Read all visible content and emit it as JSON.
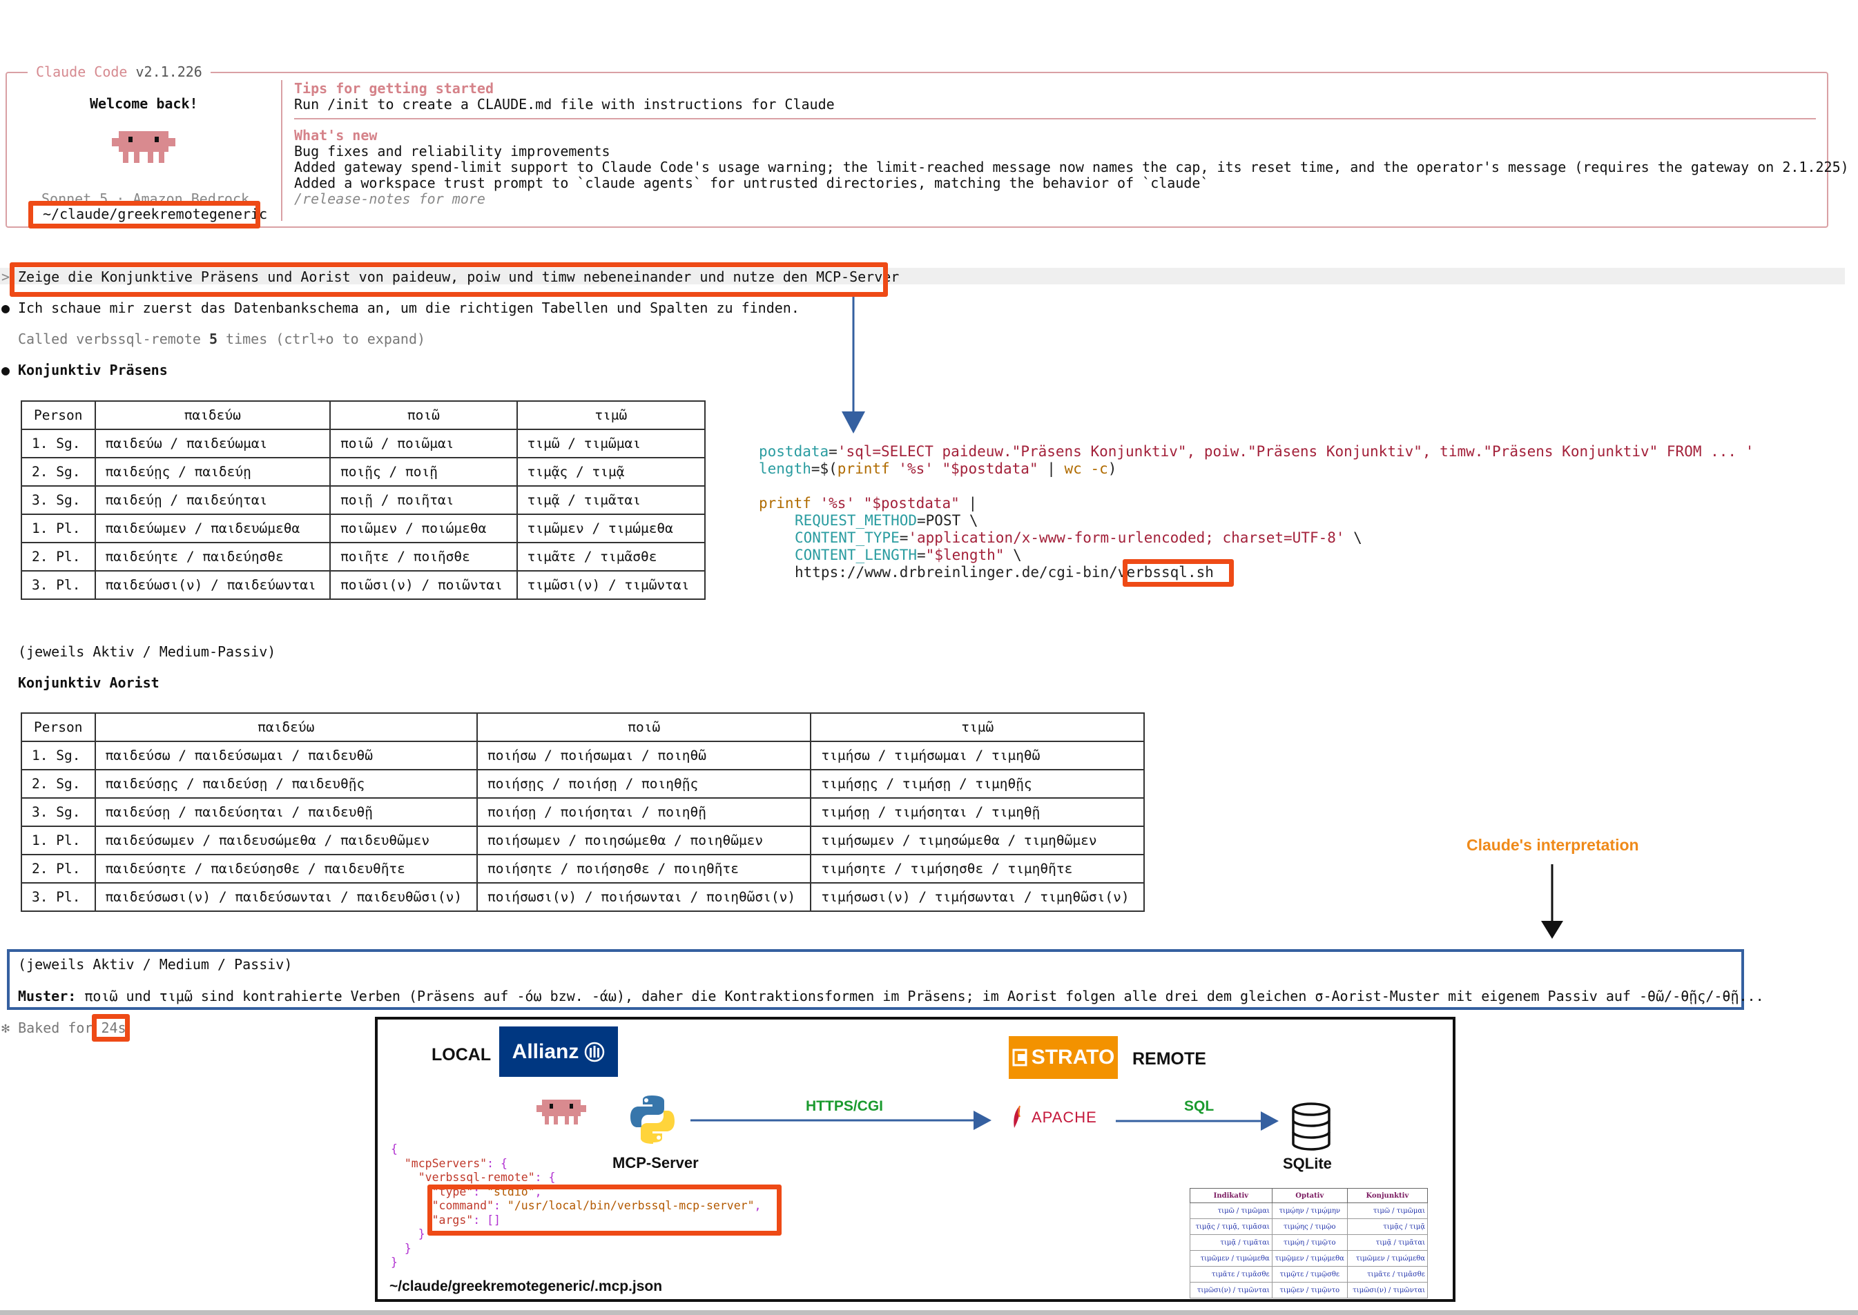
{
  "header": {
    "app_name": "Claude Code",
    "version": "v2.1.226",
    "welcome": "Welcome back!",
    "model": "Sonnet 5 · Amazon Bedrock",
    "cwd": "~/claude/greekremotegeneric",
    "tips_title": "Tips for getting started",
    "tips_line": "Run /init to create a CLAUDE.md file with instructions for Claude",
    "whats_new_title": "What's new",
    "whats_new": [
      "Bug fixes and reliability improvements",
      "Added gateway spend-limit support to Claude Code's usage warning; the limit-reached message now names the cap, its reset time, and the operator's message (requires the gateway on 2.1.225)",
      "Added a workspace trust prompt to `claude agents` for untrusted directories, matching the behavior of `claude`"
    ],
    "release_notes": "/release-notes for more"
  },
  "conversation": {
    "prompt_marker": ">",
    "prompt": "Zeige die Konjunktive Präsens und Aorist von paideuw, poiw und timw nebeneinander und nutze den MCP-Server",
    "bullet": "●",
    "msg1": "Ich schaue mir zuerst das Datenbankschema an, um die richtigen Tabellen und Spalten zu finden.",
    "called_prefix": "Called verbssql-remote ",
    "called_count": "5",
    "called_suffix": " times (ctrl+o to expand)",
    "section1_title": "Konjunktiv Präsens",
    "section2_title": "Konjunktiv Aorist",
    "note1": "(jeweils Aktiv / Medium-Passiv)",
    "note2": "(jeweils Aktiv / Medium / Passiv)",
    "muster_label": "Muster:",
    "muster_text": " ποιῶ und τιμῶ sind kontrahierte Verben (Präsens auf -όω bzw. -άω), daher die Kontraktionsformen im Präsens; im Aorist folgen alle drei dem gleichen σ-Aorist-Muster mit eigenem Passiv auf -θῶ/-θῇς/-θῇ...",
    "baked_star": "✻",
    "baked_label": "Baked for",
    "baked_time": "24s"
  },
  "table_praesens": {
    "headers": [
      "Person",
      "παιδεύω",
      "ποιῶ",
      "τιμῶ"
    ],
    "rows": [
      [
        "1. Sg.",
        "παιδεύω / παιδεύωμαι",
        "ποιῶ / ποιῶμαι",
        "τιμῶ / τιμῶμαι"
      ],
      [
        "2. Sg.",
        "παιδεύῃς / παιδεύῃ",
        "ποιῇς / ποιῇ",
        "τιμᾷς / τιμᾷ"
      ],
      [
        "3. Sg.",
        "παιδεύῃ / παιδεύηται",
        "ποιῇ / ποιῆται",
        "τιμᾷ / τιμᾶται"
      ],
      [
        "1. Pl.",
        "παιδεύωμεν / παιδευώμεθα",
        "ποιῶμεν / ποιώμεθα",
        "τιμῶμεν / τιμώμεθα"
      ],
      [
        "2. Pl.",
        "παιδεύητε / παιδεύησθε",
        "ποιῆτε / ποιῆσθε",
        "τιμᾶτε / τιμᾶσθε"
      ],
      [
        "3. Pl.",
        "παιδεύωσι(ν) / παιδεύωνται",
        "ποιῶσι(ν) / ποιῶνται",
        "τιμῶσι(ν) / τιμῶνται"
      ]
    ]
  },
  "table_aorist": {
    "headers": [
      "Person",
      "παιδεύω",
      "ποιῶ",
      "τιμῶ"
    ],
    "rows": [
      [
        "1. Sg.",
        "παιδεύσω / παιδεύσωμαι / παιδευθῶ",
        "ποιήσω / ποιήσωμαι / ποιηθῶ",
        "τιμήσω / τιμήσωμαι / τιμηθῶ"
      ],
      [
        "2. Sg.",
        "παιδεύσῃς / παιδεύσῃ / παιδευθῇς",
        "ποιήσῃς / ποιήσῃ / ποιηθῇς",
        "τιμήσῃς / τιμήσῃ / τιμηθῇς"
      ],
      [
        "3. Sg.",
        "παιδεύσῃ / παιδεύσηται / παιδευθῇ",
        "ποιήσῃ / ποιήσηται / ποιηθῇ",
        "τιμήσῃ / τιμήσηται / τιμηθῇ"
      ],
      [
        "1. Pl.",
        "παιδεύσωμεν / παιδευσώμεθα / παιδευθῶμεν",
        "ποιήσωμεν / ποιησώμεθα / ποιηθῶμεν",
        "τιμήσωμεν / τιμησώμεθα / τιμηθῶμεν"
      ],
      [
        "2. Pl.",
        "παιδεύσητε / παιδεύσησθε / παιδευθῆτε",
        "ποιήσητε / ποιήσησθε / ποιηθῆτε",
        "τιμήσητε / τιμήσησθε / τιμηθῆτε"
      ],
      [
        "3. Pl.",
        "παιδεύσωσι(ν) / παιδεύσωνται / παιδευθῶσι(ν)",
        "ποιήσωσι(ν) / ποιήσωνται / ποιηθῶσι(ν)",
        "τιμήσωσι(ν) / τιμήσωνται / τιμηθῶσι(ν)"
      ]
    ]
  },
  "code": {
    "l1_var": "postdata",
    "l1_eq": "=",
    "l1_str": "'sql=SELECT paideuw.\"Präsens Konjunktiv\", poiw.\"Präsens Konjunktiv\", timw.\"Präsens Konjunktiv\" FROM ... '",
    "l2_var": "length",
    "l2_eq": "=$(",
    "l2_fn": "printf",
    "l2_str1": " '%s' ",
    "l2_str2": "\"$postdata\"",
    "l2_pipe": " | ",
    "l2_fn2": "wc -c",
    "l2_end": ")",
    "l4_fn": "printf",
    "l4_str": " '%s' \"$postdata\"",
    "l4_pipe": " |",
    "l5_var": "REQUEST_METHOD",
    "l5_val": "=POST \\",
    "l6_var": "CONTENT_TYPE",
    "l6_eq": "=",
    "l6_str": "'application/x-www-form-urlencoded; charset=UTF-8'",
    "l6_end": " \\",
    "l7_var": "CONTENT_LENGTH",
    "l7_eq": "=",
    "l7_str": "\"$length\"",
    "l7_end": " \\",
    "l8_url": "https://www.drbreinlinger.de/cgi-bin/",
    "l8_script": "verbssql.sh"
  },
  "annotation": {
    "label": "Claude's interpretation"
  },
  "diagram": {
    "local_label": "LOCAL",
    "allianz_label": "Allianz",
    "strato_label": "STRATO",
    "remote_label": "REMOTE",
    "mcp_label": "MCP-Server",
    "https_label": "HTTPS/CGI",
    "apache_label": "APACHE",
    "sql_label": "SQL",
    "sqlite_label": "SQLite",
    "json_path": "~/claude/greekremotegeneric/.mcp.json",
    "json": {
      "open": "{",
      "servers_key": "\"mcpServers\"",
      "server_key": "\"verbssql-remote\"",
      "type_key": "\"type\"",
      "type_val": "\"stdio\"",
      "command_key": "\"command\"",
      "command_val": "\"/usr/local/bin/verbssql-mcp-server\"",
      "args_key": "\"args\"",
      "args_val": "[]",
      "close": "}"
    },
    "mini_table": {
      "headers": [
        "Indikativ",
        "Optativ",
        "Konjunktiv"
      ],
      "rows": [
        [
          "τιμῶ / τιμῶμαι",
          "τιμῴην / τιμῴμην",
          "τιμῶ / τιμῶμαι"
        ],
        [
          "τιμᾷς / τιμᾷ, τιμᾶσαι",
          "τιμῴης / τιμῷο",
          "τιμᾷς / τιμᾷ"
        ],
        [
          "τιμᾷ / τιμᾶται",
          "τιμῴη / τιμῷτο",
          "τιμᾷ / τιμᾶται"
        ],
        [
          "τιμῶμεν / τιμώμεθα",
          "τιμῷμεν / τιμῴμεθα",
          "τιμῶμεν / τιμώμεθα"
        ],
        [
          "τιμᾶτε / τιμᾶσθε",
          "τιμῷτε / τιμῷσθε",
          "τιμᾶτε / τιμᾶσθε"
        ],
        [
          "τιμῶσι(ν) / τιμῶνται",
          "τιμῷεν / τιμῷντο",
          "τιμῶσι(ν) / τιμῶνται"
        ]
      ]
    }
  },
  "colors": {
    "highlight": "#ee4a16",
    "accent": "#d58289",
    "arrow_blue": "#3560a0",
    "annotation_orange": "#ef8a1a",
    "https_green": "#1a9a2e",
    "allianz_blue": "#003781",
    "strato_orange": "#f39200"
  }
}
